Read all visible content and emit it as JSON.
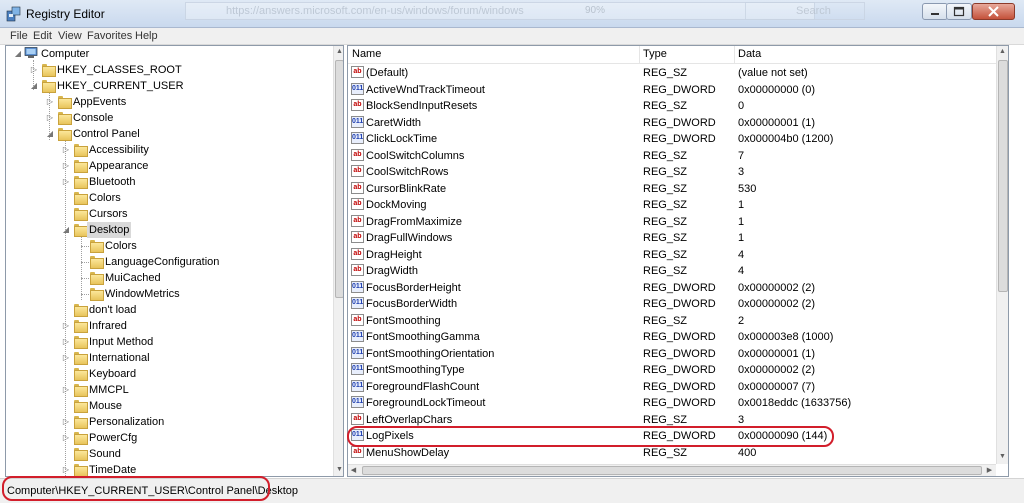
{
  "window": {
    "title": "Registry Editor",
    "background_address": "https://answers.microsoft.com/en-us/windows/forum/windows",
    "background_zoom": "90%",
    "background_search": "Search"
  },
  "menu": [
    "File",
    "Edit",
    "View",
    "Favorites",
    "Help"
  ],
  "tree": {
    "root": "Computer",
    "hkcr": "HKEY_CLASSES_ROOT",
    "hkcu": "HKEY_CURRENT_USER",
    "hkcu_children": [
      "AppEvents",
      "Console",
      "Control Panel"
    ],
    "control_panel_children": [
      "Accessibility",
      "Appearance",
      "Bluetooth",
      "Colors",
      "Cursors",
      "Desktop"
    ],
    "desktop_children": [
      "Colors",
      "LanguageConfiguration",
      "MuiCached",
      "WindowMetrics"
    ],
    "control_panel_more": [
      "don't load",
      "Infrared",
      "Input Method",
      "International",
      "Keyboard",
      "MMCPL",
      "Mouse",
      "Personalization",
      "PowerCfg",
      "Sound",
      "TimeDate"
    ]
  },
  "list": {
    "columns": {
      "name": "Name",
      "type": "Type",
      "data": "Data"
    },
    "rows": [
      {
        "name": "(Default)",
        "type": "REG_SZ",
        "data": "(value not set)",
        "icon": "string-value-icon"
      },
      {
        "name": "ActiveWndTrackTimeout",
        "type": "REG_DWORD",
        "data": "0x00000000 (0)",
        "icon": "dword-value-icon"
      },
      {
        "name": "BlockSendInputResets",
        "type": "REG_SZ",
        "data": "0",
        "icon": "string-value-icon"
      },
      {
        "name": "CaretWidth",
        "type": "REG_DWORD",
        "data": "0x00000001 (1)",
        "icon": "dword-value-icon"
      },
      {
        "name": "ClickLockTime",
        "type": "REG_DWORD",
        "data": "0x000004b0 (1200)",
        "icon": "dword-value-icon"
      },
      {
        "name": "CoolSwitchColumns",
        "type": "REG_SZ",
        "data": "7",
        "icon": "string-value-icon"
      },
      {
        "name": "CoolSwitchRows",
        "type": "REG_SZ",
        "data": "3",
        "icon": "string-value-icon"
      },
      {
        "name": "CursorBlinkRate",
        "type": "REG_SZ",
        "data": "530",
        "icon": "string-value-icon"
      },
      {
        "name": "DockMoving",
        "type": "REG_SZ",
        "data": "1",
        "icon": "string-value-icon"
      },
      {
        "name": "DragFromMaximize",
        "type": "REG_SZ",
        "data": "1",
        "icon": "string-value-icon"
      },
      {
        "name": "DragFullWindows",
        "type": "REG_SZ",
        "data": "1",
        "icon": "string-value-icon"
      },
      {
        "name": "DragHeight",
        "type": "REG_SZ",
        "data": "4",
        "icon": "string-value-icon"
      },
      {
        "name": "DragWidth",
        "type": "REG_SZ",
        "data": "4",
        "icon": "string-value-icon"
      },
      {
        "name": "FocusBorderHeight",
        "type": "REG_DWORD",
        "data": "0x00000002 (2)",
        "icon": "dword-value-icon"
      },
      {
        "name": "FocusBorderWidth",
        "type": "REG_DWORD",
        "data": "0x00000002 (2)",
        "icon": "dword-value-icon"
      },
      {
        "name": "FontSmoothing",
        "type": "REG_SZ",
        "data": "2",
        "icon": "string-value-icon"
      },
      {
        "name": "FontSmoothingGamma",
        "type": "REG_DWORD",
        "data": "0x000003e8 (1000)",
        "icon": "dword-value-icon"
      },
      {
        "name": "FontSmoothingOrientation",
        "type": "REG_DWORD",
        "data": "0x00000001 (1)",
        "icon": "dword-value-icon"
      },
      {
        "name": "FontSmoothingType",
        "type": "REG_DWORD",
        "data": "0x00000002 (2)",
        "icon": "dword-value-icon"
      },
      {
        "name": "ForegroundFlashCount",
        "type": "REG_DWORD",
        "data": "0x00000007 (7)",
        "icon": "dword-value-icon"
      },
      {
        "name": "ForegroundLockTimeout",
        "type": "REG_DWORD",
        "data": "0x0018eddc (1633756)",
        "icon": "dword-value-icon"
      },
      {
        "name": "LeftOverlapChars",
        "type": "REG_SZ",
        "data": "3",
        "icon": "string-value-icon"
      },
      {
        "name": "LogPixels",
        "type": "REG_DWORD",
        "data": "0x00000090 (144)",
        "icon": "dword-value-icon"
      },
      {
        "name": "MenuShowDelay",
        "type": "REG_SZ",
        "data": "400",
        "icon": "string-value-icon"
      }
    ]
  },
  "status": {
    "path": "Computer\\HKEY_CURRENT_USER\\Control Panel\\Desktop"
  },
  "colors": {
    "highlight": "#d21e2b",
    "selection": "#d9d9d9",
    "titlebar": "#c9d9ee"
  }
}
